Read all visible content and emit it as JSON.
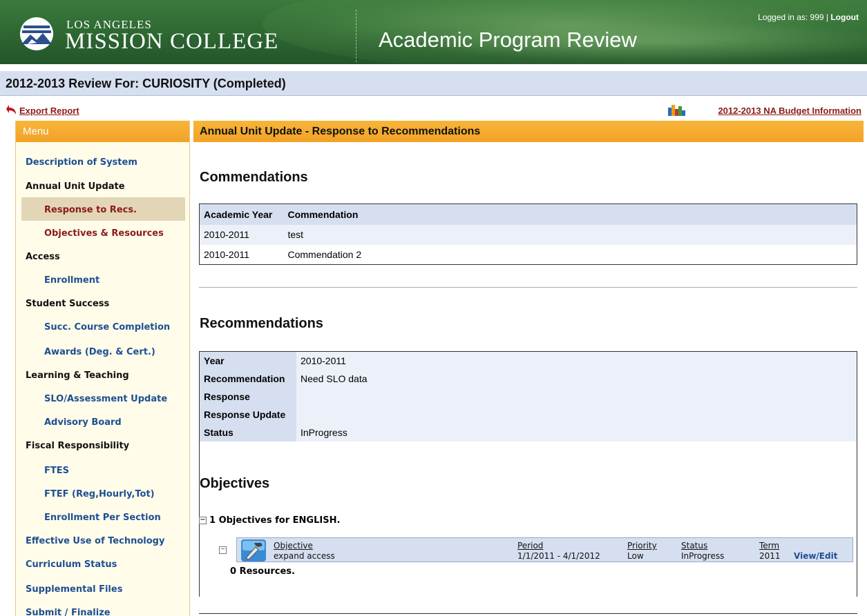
{
  "header": {
    "college_line1": "LOS ANGELES",
    "college_line2": "MISSION COLLEGE",
    "app_title": "Academic Program Review",
    "logged_in_text": "Logged in as: 999 | ",
    "logout_label": "Logout"
  },
  "review_title": "2012-2013 Review For: CURIOSITY (Completed)",
  "export_label": "Export Report",
  "budget_label": "2012-2013 NA Budget Information",
  "menu": {
    "title": "Menu",
    "items": [
      {
        "label": "Description of System",
        "kind": "link"
      },
      {
        "label": "Annual Unit Update",
        "kind": "head"
      },
      {
        "label": "Response to Recs.",
        "kind": "sub-active"
      },
      {
        "label": "Objectives & Resources",
        "kind": "sub-red"
      },
      {
        "label": "Access",
        "kind": "head"
      },
      {
        "label": "Enrollment",
        "kind": "sub"
      },
      {
        "label": "Student Success",
        "kind": "head"
      },
      {
        "label": "Succ. Course Completion",
        "kind": "sub"
      },
      {
        "label": "Awards (Deg. & Cert.)",
        "kind": "sub"
      },
      {
        "label": "Learning & Teaching",
        "kind": "head"
      },
      {
        "label": "SLO/Assessment Update",
        "kind": "sub"
      },
      {
        "label": "Advisory Board",
        "kind": "sub"
      },
      {
        "label": "Fiscal Responsibility",
        "kind": "head"
      },
      {
        "label": "FTES",
        "kind": "sub"
      },
      {
        "label": "FTEF (Reg,Hourly,Tot)",
        "kind": "sub"
      },
      {
        "label": "Enrollment Per Section",
        "kind": "sub"
      },
      {
        "label": "Effective Use of Technology",
        "kind": "link"
      },
      {
        "label": "Curriculum Status",
        "kind": "link"
      },
      {
        "label": "Supplemental Files",
        "kind": "link"
      },
      {
        "label": "Submit / Finalize",
        "kind": "link"
      }
    ]
  },
  "main": {
    "title": "Annual Unit Update - Response to Recommendations",
    "commendations": {
      "heading": "Commendations",
      "columns": [
        "Academic Year",
        "Commendation"
      ],
      "rows": [
        [
          "2010-2011",
          "test"
        ],
        [
          "2010-2011",
          "Commendation 2"
        ]
      ]
    },
    "recommendations": {
      "heading": "Recommendations",
      "fields": [
        {
          "label": "Year",
          "value": "2010-2011"
        },
        {
          "label": "Recommendation",
          "value": "Need SLO data"
        },
        {
          "label": "Response",
          "value": ""
        },
        {
          "label": "Response Update",
          "value": ""
        },
        {
          "label": "Status",
          "value": "InProgress"
        }
      ]
    },
    "objectives": {
      "heading": "Objectives",
      "group_label": "1 Objectives for ENGLISH.",
      "toggle_symbol": "−",
      "columns": {
        "objective": "Objective",
        "period": "Period",
        "priority": "Priority",
        "status": "Status",
        "term": "Term"
      },
      "row": {
        "objective": "expand access",
        "period": "1/1/2011 - 4/1/2012",
        "priority": "Low",
        "status": "InProgress",
        "term": "2011",
        "action": "View/Edit"
      },
      "resources_label": "0 Resources."
    }
  },
  "colors": {
    "header_green": "#2f6a33",
    "menu_orange": "#f2a227",
    "link_blue": "#1e4f94",
    "link_red": "#8b1a1a",
    "grid_blue": "#d6dff0"
  }
}
